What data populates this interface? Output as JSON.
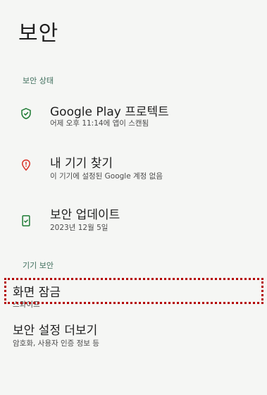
{
  "page": {
    "title": "보안"
  },
  "sections": {
    "status_header": "보안 상태",
    "device_header": "기기 보안"
  },
  "status_items": [
    {
      "title": "Google Play 프로텍트",
      "subtitle": "어제 오후 11:14에 앱이 스캔됨",
      "icon": "shield-check-icon",
      "color": "#1e7b34"
    },
    {
      "title": "내 기기 찾기",
      "subtitle": "이 기기에 설정된 Google 계정 없음",
      "icon": "location-alert-icon",
      "color": "#d93025"
    },
    {
      "title": "보안 업데이트",
      "subtitle": "2023년 12월 5일",
      "icon": "phone-check-icon",
      "color": "#1e7b34"
    }
  ],
  "device_items": [
    {
      "title": "화면 잠금",
      "subtitle": "스와이프"
    },
    {
      "title": "보안 설정 더보기",
      "subtitle": "암호화, 사용자 인증 정보 등"
    }
  ],
  "colors": {
    "background": "#f5f6f4",
    "section_header": "#3f6e5c",
    "highlight": "#b40000"
  }
}
